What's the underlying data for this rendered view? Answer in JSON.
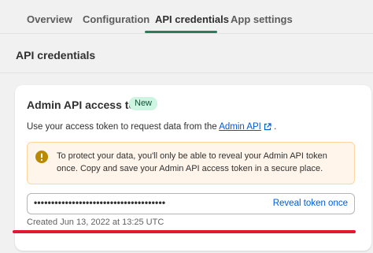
{
  "tabs": [
    {
      "label": "Overview",
      "active": false
    },
    {
      "label": "Configuration",
      "active": false
    },
    {
      "label": "API credentials",
      "active": true
    },
    {
      "label": "App settings",
      "active": false
    }
  ],
  "section": {
    "title": "API credentials"
  },
  "card": {
    "title": "Admin API access token",
    "badge": "New",
    "description_prefix": "Use your access token to request data from the ",
    "description_link": "Admin API",
    "description_suffix": " .",
    "banner_text": "To protect your data, you'll only be able to reveal your Admin API token once. Copy and save your Admin API access token in a secure place.",
    "token_masked": "••••••••••••••••••••••••••••••••••••••",
    "reveal_label": "Reveal token once",
    "created_text": "Created Jun 13, 2022 at 13:25 UTC"
  },
  "icons": {
    "warning": "warning-circle-icon",
    "external": "external-link-icon"
  },
  "colors": {
    "active_tab_underline": "#2f7a5b",
    "badge_bg": "#cdf5e1",
    "link": "#005bd3",
    "banner_bg": "#fff5ea",
    "banner_border": "#ffd79d",
    "warning_icon": "#b98900",
    "annotation_line": "#e3172f"
  }
}
